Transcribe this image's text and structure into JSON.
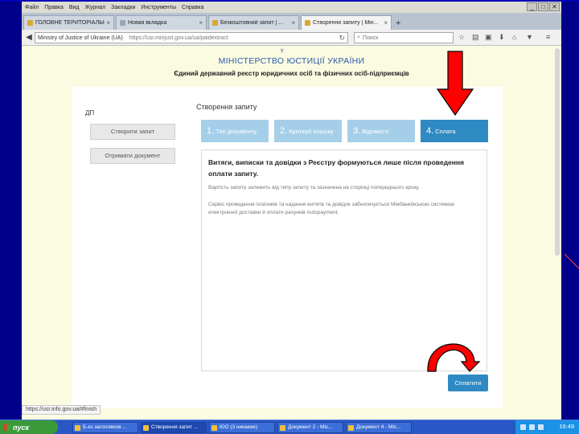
{
  "menu": [
    "Файл",
    "Правка",
    "Вид",
    "Журнал",
    "Закладки",
    "Инструменты",
    "Справка"
  ],
  "window_controls": [
    "_",
    "□",
    "✕"
  ],
  "tabs": [
    {
      "label": "ГОЛОВНЕ ТЕРИТОРІАЛЬНЕ ...",
      "close": "×"
    },
    {
      "label": "Новая вкладка",
      "close": "×"
    },
    {
      "label": "Безкоштовний запит | ...",
      "close": "×"
    },
    {
      "label": "Створення запиту | Мін...",
      "close": "×"
    }
  ],
  "new_tab_symbol": "+",
  "address": {
    "site": "Ministry of Justice of Ukraine (UA)",
    "path": "https://usr.minjust.gov.ua/ua/paidextract"
  },
  "search": {
    "placeholder": "Поиск"
  },
  "header": {
    "ministry": "МІНІСТЕРСТВО ЮСТИЦІЇ УКРАЇНИ",
    "registry": "Єдиний державний реєстр юридичних осіб та фізичних осіб-підприємців"
  },
  "sidebar": {
    "label": "ДП",
    "create_request": "Створити запит",
    "get_document": "Отримати документ"
  },
  "main": {
    "heading": "Створення запиту",
    "steps": [
      {
        "num": "1.",
        "label": "Тип документу"
      },
      {
        "num": "2.",
        "label": "Критерії пошуку"
      },
      {
        "num": "3.",
        "label": "Відомості"
      },
      {
        "num": "4.",
        "label": "Сплата"
      }
    ],
    "active_step": 4,
    "info_bold": "Витяги, виписки та довідки з Реєстру формуються лише після проведення оплати запиту.",
    "info_cost": "Вартість запиту залежить від типу запиту та зазначена на сторінці попереднього кроку.",
    "info_service": "Сервіс проведення платежів та надання витягів та довідок забезпечується Міжбанківською системою електронної доставки й оплати рахунків Autopayment.",
    "pay_button": "Сплатити"
  },
  "status_url": "https://usr.info.gov.ua/#finish",
  "taskbar": {
    "start": "пуск",
    "tasks": [
      "Б.ез заголовков ...",
      "Створення запит ...",
      "ЮО (3 никакие)",
      "Документ 2 - Mic...",
      "Документ 4 - Mic..."
    ],
    "clock": "16:49"
  },
  "colors": {
    "step_active": "#2f8ac3",
    "step_inactive": "#a5cfe9",
    "pay_button": "#2f8ac3",
    "page_background": "#fbfbe2",
    "annotation_arrow": "#ff0000"
  }
}
